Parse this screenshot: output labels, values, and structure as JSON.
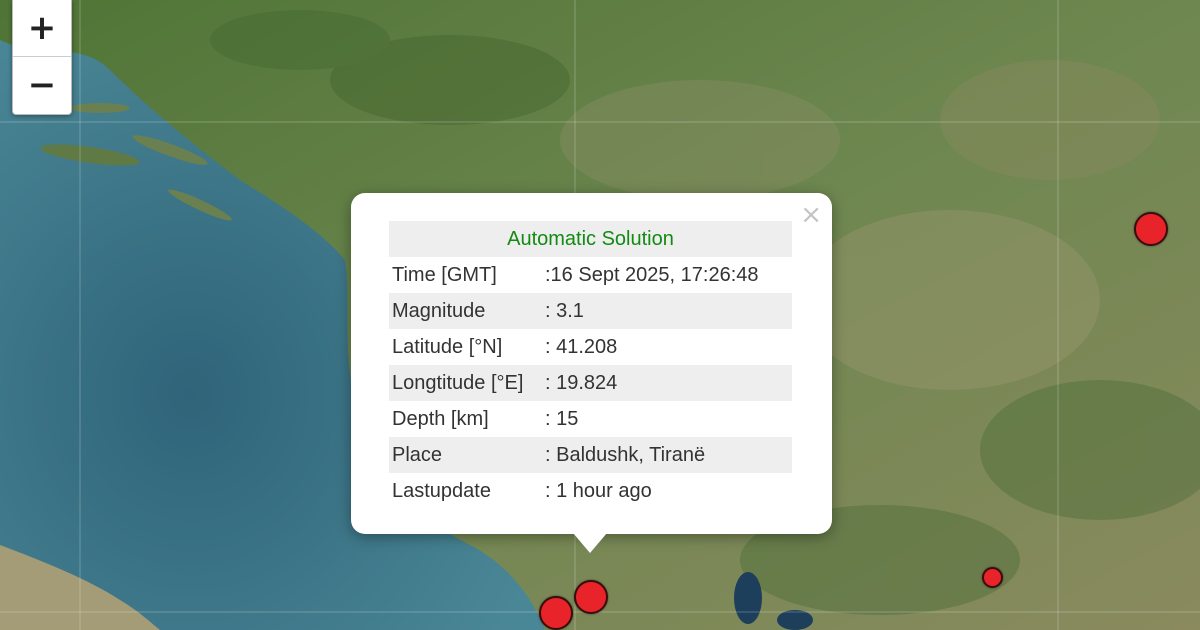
{
  "map": {
    "zoom_in_label": "+",
    "zoom_out_label": "−",
    "sea_color": "#3f7a8a",
    "land_color": "#5a7a3a",
    "marker_color": "#e8242a"
  },
  "popup": {
    "close_label": "×",
    "title": "Automatic Solution",
    "title_color": "#138a13",
    "rows": [
      {
        "label": "Time [GMT]",
        "value": ":16 Sept 2025, 17:26:48"
      },
      {
        "label": "Magnitude",
        "value": ": 3.1"
      },
      {
        "label": "Latitude [°N]",
        "value": ": 41.208"
      },
      {
        "label": "Longtitude [°E]",
        "value": ": 19.824"
      },
      {
        "label": "Depth [km]",
        "value": ": 15"
      },
      {
        "label": "Place",
        "value": ": Baldushk, Tiranë"
      },
      {
        "label": "Lastupdate",
        "value": ": 1 hour ago"
      }
    ]
  }
}
